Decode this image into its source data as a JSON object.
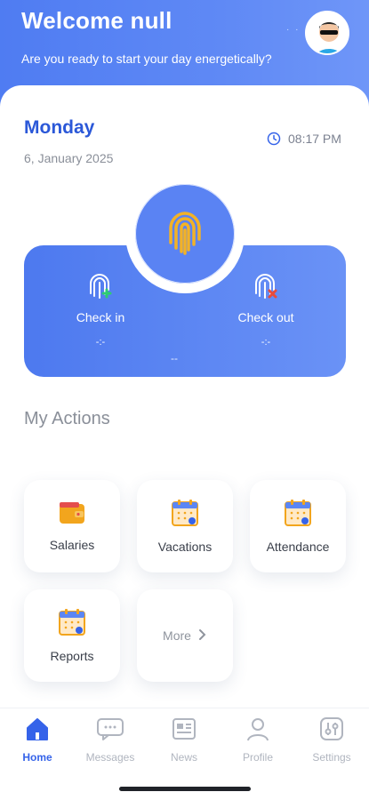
{
  "header": {
    "welcome": "Welcome null",
    "subtitle": "Are you ready to start your day energetically?"
  },
  "card": {
    "day": "Monday",
    "date": "6, January 2025",
    "time": "08:17 PM",
    "check_in": {
      "label": "Check in",
      "value": "-:-"
    },
    "check_out": {
      "label": "Check out",
      "value": "-:-"
    },
    "middle_value": "--"
  },
  "actions": {
    "title": "My Actions",
    "items": [
      {
        "label": "Salaries",
        "icon": "wallet-icon"
      },
      {
        "label": "Vacations",
        "icon": "calendar-icon"
      },
      {
        "label": "Attendance",
        "icon": "calendar-icon"
      },
      {
        "label": "Reports",
        "icon": "calendar-icon"
      }
    ],
    "more": "More"
  },
  "nav": {
    "items": [
      {
        "label": "Home",
        "active": true
      },
      {
        "label": "Messages"
      },
      {
        "label": "News"
      },
      {
        "label": "Profile"
      },
      {
        "label": "Settings"
      }
    ]
  },
  "colors": {
    "primary": "#3563e9",
    "header_bg": "#5a83f3",
    "fingerprint": "#f2b227",
    "check_in_dot": "#2ecc71",
    "check_out_dot": "#e74c3c"
  }
}
